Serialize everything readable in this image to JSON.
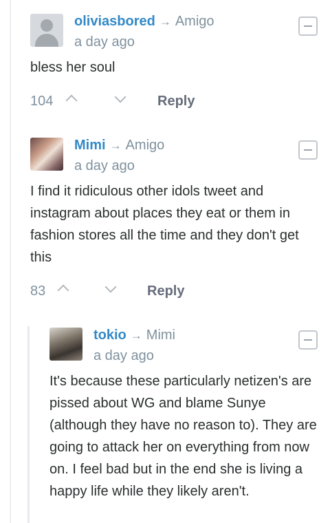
{
  "comments": [
    {
      "author": "oliviasbored",
      "reply_to": "Amigo",
      "time": "a day ago",
      "text": "bless her soul",
      "votes": "104",
      "reply_label": "Reply"
    },
    {
      "author": "Mimi",
      "reply_to": "Amigo",
      "time": "a day ago",
      "text": "I find it ridiculous other idols tweet and instagram about places they eat or them in fashion stores all the time and they don't get this",
      "votes": "83",
      "reply_label": "Reply"
    },
    {
      "author": "tokio",
      "reply_to": "Mimi",
      "time": "a day ago",
      "text": "It's because these particularly netizen's are pissed about WG and blame Sunye (although they have no reason to). They are going to attack her on everything from now on. I feel bad but in the end she is living a happy life while they likely aren't."
    }
  ],
  "icons": {
    "reply_arrow": "→",
    "collapse": "minus-box-icon",
    "upvote": "chevron-up-icon",
    "downvote": "chevron-down-icon"
  },
  "colors": {
    "author": "#3289c7",
    "meta": "#7f919e",
    "text": "#2a2e2e",
    "reply_button": "#656c7a"
  }
}
